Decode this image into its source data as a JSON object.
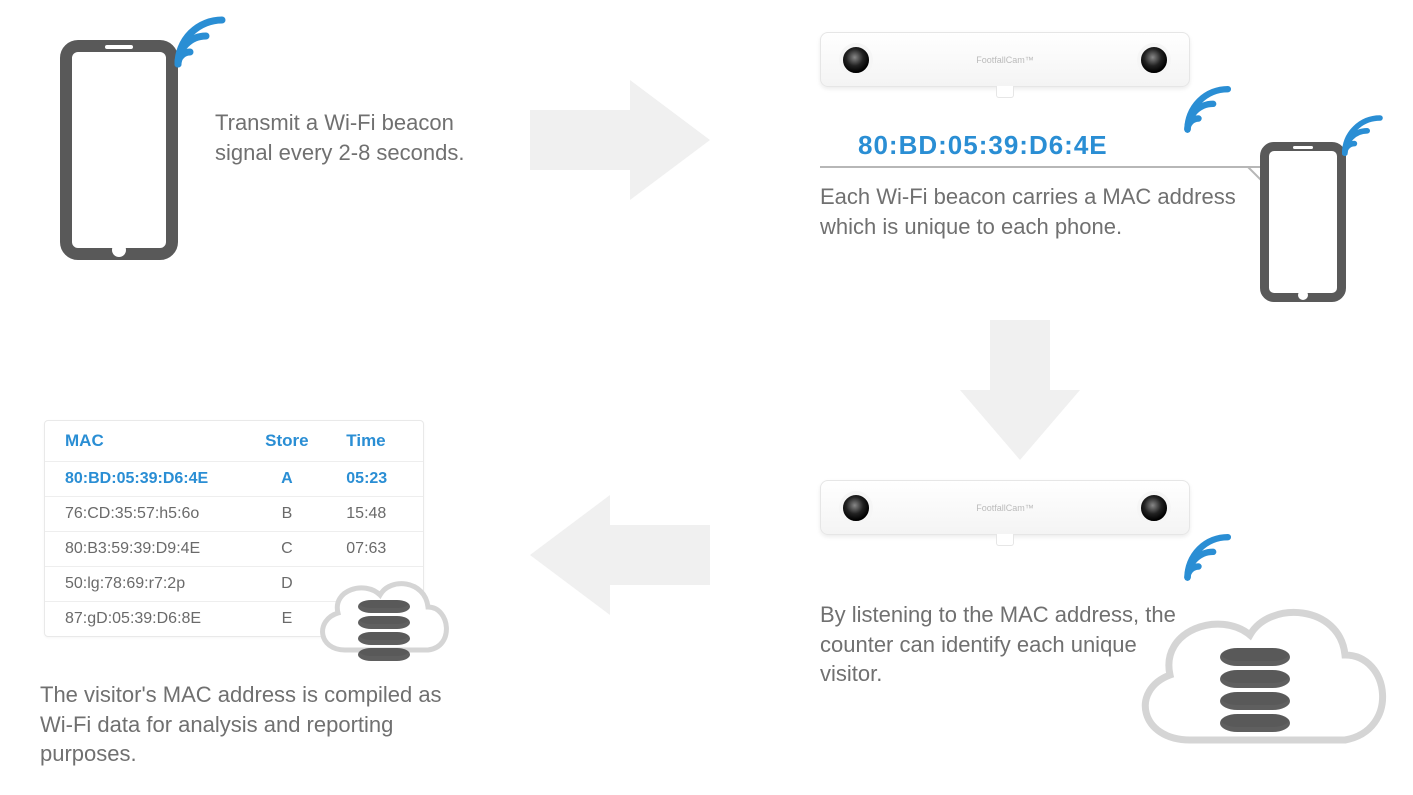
{
  "step1": {
    "text": "Transmit a Wi-Fi beacon signal every 2-8 seconds."
  },
  "step2": {
    "mac": "80:BD:05:39:D6:4E",
    "text": "Each Wi-Fi beacon carries a MAC address which is unique to each phone."
  },
  "step3": {
    "text": "By listening to the MAC address, the counter can identify each unique visitor."
  },
  "step4": {
    "text": "The visitor's MAC address is compiled as Wi-Fi data for analysis and reporting purposes."
  },
  "sensor_brand": "FootfallCam™",
  "table": {
    "headers": {
      "mac": "MAC",
      "store": "Store",
      "time": "Time"
    },
    "rows": [
      {
        "mac": "80:BD:05:39:D6:4E",
        "store": "A",
        "time": "05:23",
        "highlight": true
      },
      {
        "mac": "76:CD:35:57:h5:6o",
        "store": "B",
        "time": "15:48"
      },
      {
        "mac": "80:B3:59:39:D9:4E",
        "store": "C",
        "time": "07:63"
      },
      {
        "mac": "50:lg:78:69:r7:2p",
        "store": "D",
        "time": ""
      },
      {
        "mac": "87:gD:05:39:D6:8E",
        "store": "E",
        "time": ""
      }
    ]
  }
}
